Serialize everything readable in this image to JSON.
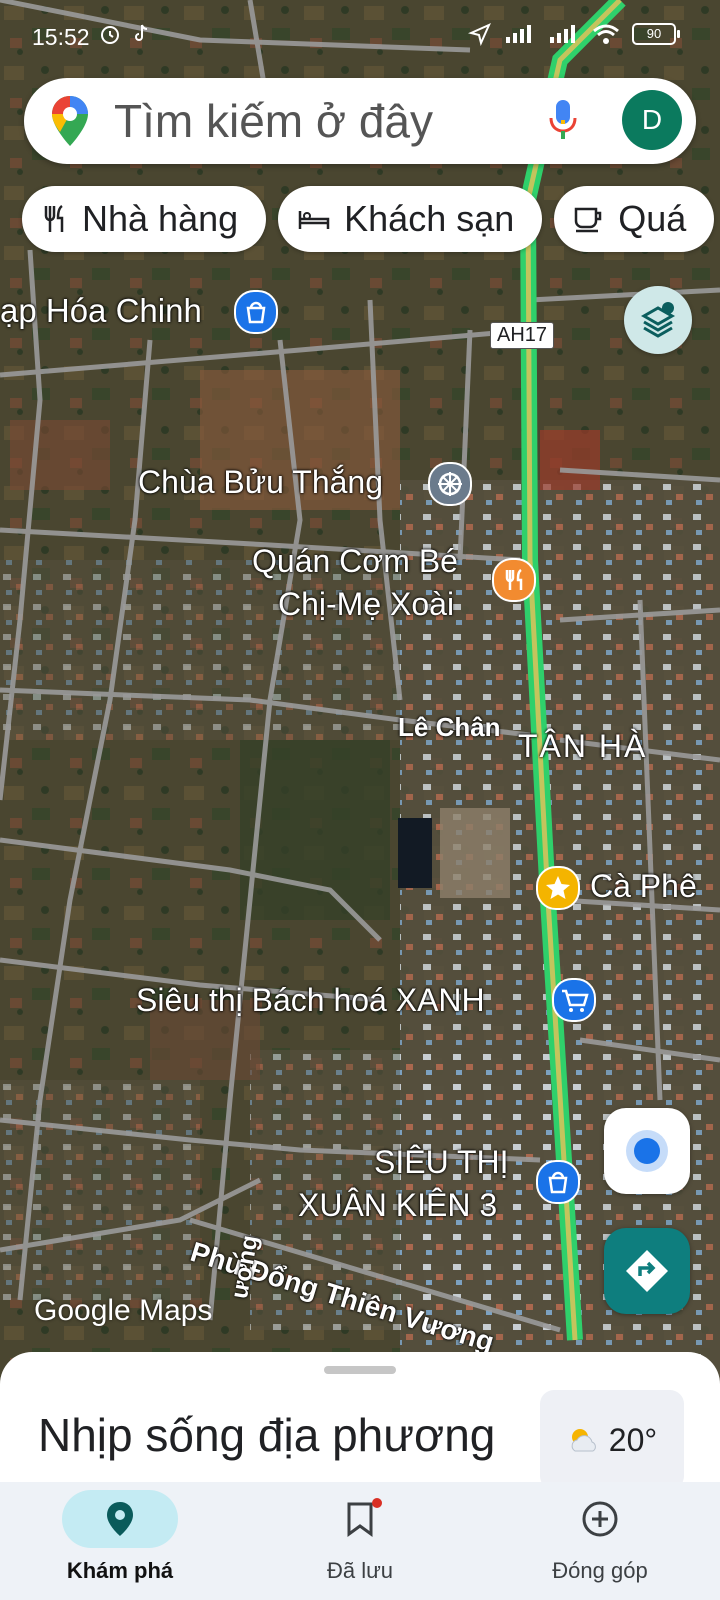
{
  "status_bar": {
    "time": "15:52",
    "battery": "90"
  },
  "search": {
    "placeholder": "Tìm kiếm ở đây",
    "avatar_letter": "D"
  },
  "chips": [
    {
      "label": "Nhà hàng",
      "icon": "restaurant-icon"
    },
    {
      "label": "Khách sạn",
      "icon": "hotel-icon"
    },
    {
      "label": "Quá",
      "icon": "cafe-icon"
    }
  ],
  "map_labels": {
    "tap_hoa": "ạp Hóa Chinh",
    "chua": "Chùa Bửu Thắng",
    "quan_com_1": "Quán Cơm Bé",
    "quan_com_2": "Chị-Mẹ Xoài",
    "le_chan": "Lê Chân",
    "tan_ha": "TÂN HÀ",
    "ca_phe": "Cà Phê",
    "sieu_thi_bhx": "Siêu thị Bách hoá XANH",
    "sieu_thi_xk_1": "SIÊU THỊ",
    "sieu_thi_xk_2": "XUÂN KIÊN 3",
    "phu_dong": "Phù Đổng Thiên Vương",
    "road_shield": "AH17",
    "side_street": "ương"
  },
  "google_logo": "Google Maps",
  "sheet": {
    "title": "Nhịp sống địa phương",
    "temperature": "20°"
  },
  "nav": [
    {
      "label": "Khám phá",
      "icon": "explore-pin-icon",
      "active": true
    },
    {
      "label": "Đã lưu",
      "icon": "bookmark-icon",
      "active": false
    },
    {
      "label": "Đóng góp",
      "icon": "add-circle-icon",
      "active": false
    }
  ],
  "colors": {
    "highway": "#2fd06b",
    "highway_center": "#e8c15a",
    "road": "#9a9a9a",
    "avatar": "#0b7a5e",
    "directions": "#0e7e7e",
    "poi_shop": "#1a73e8",
    "poi_food": "#f28b30",
    "poi_star": "#f4b400",
    "poi_temple": "#6b7b8c"
  }
}
